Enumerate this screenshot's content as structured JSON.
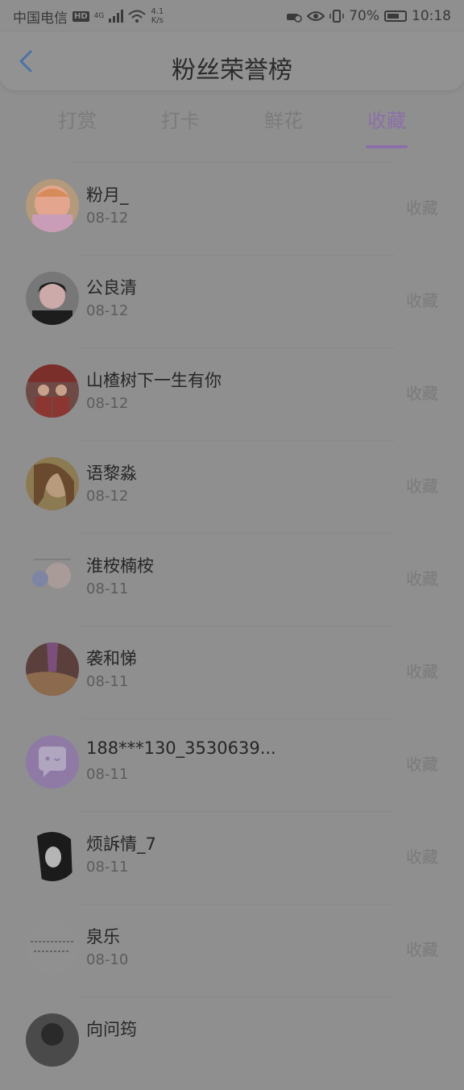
{
  "status_bar": {
    "carrier": "中国电信",
    "hd": "HD",
    "network": "4G",
    "speed_value": "4.1",
    "speed_unit": "K/s",
    "battery": "70%",
    "battery_level": 0.7,
    "time": "10:18"
  },
  "header": {
    "title": "粉丝荣誉榜",
    "back_icon": "chevron-left-icon"
  },
  "tabs": [
    {
      "label": "打赏",
      "active": false
    },
    {
      "label": "打卡",
      "active": false
    },
    {
      "label": "鲜花",
      "active": false
    },
    {
      "label": "收藏",
      "active": true
    }
  ],
  "colors": {
    "accent": "#8b6fa8",
    "overlay_bg": "#8f8f8f"
  },
  "list": [
    {
      "name": "粉月_",
      "date": "08-12",
      "action": "收藏"
    },
    {
      "name": "公良清",
      "date": "08-12",
      "action": "收藏"
    },
    {
      "name": "山楂树下一生有你",
      "date": "08-12",
      "action": "收藏"
    },
    {
      "name": "语黎淼",
      "date": "08-12",
      "action": "收藏"
    },
    {
      "name": "淮桉楠桉",
      "date": "08-11",
      "action": "收藏"
    },
    {
      "name": "袭和悌",
      "date": "08-11",
      "action": "收藏"
    },
    {
      "name": "188***130_3530639...",
      "date": "08-11",
      "action": "收藏"
    },
    {
      "name": "烦訴情_7",
      "date": "08-11",
      "action": "收藏"
    },
    {
      "name": "泉乐",
      "date": "08-10",
      "action": "收藏"
    },
    {
      "name": "向问筠",
      "date": "",
      "action": ""
    }
  ]
}
